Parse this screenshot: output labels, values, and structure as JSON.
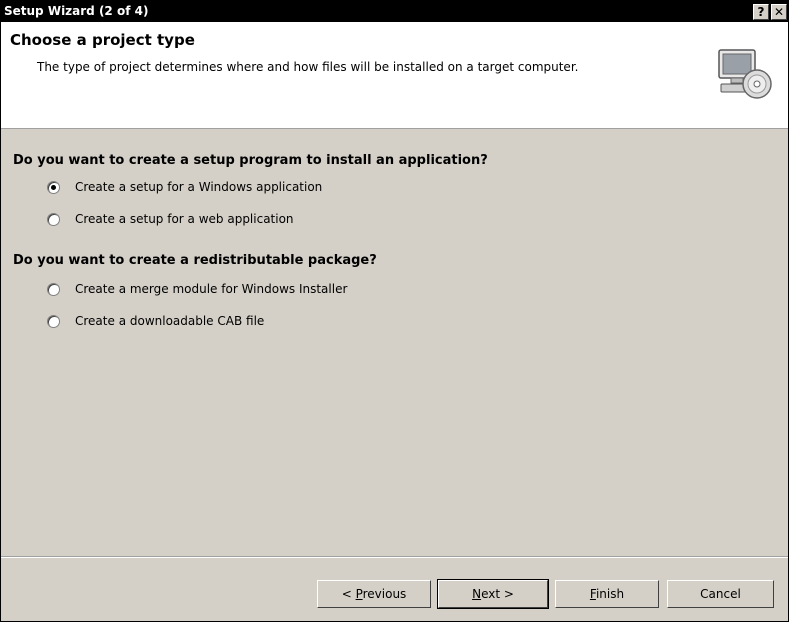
{
  "window": {
    "title": "Setup Wizard (2 of 4)",
    "help_label": "?",
    "close_label": "✕"
  },
  "header": {
    "title": "Choose a project type",
    "description": "The type of project determines where and how files will be installed on a target computer.",
    "icon": "computer-cd-icon"
  },
  "group1": {
    "question": "Do you want to create a setup program to install an application?",
    "options": [
      {
        "label": "Create a setup for a Windows application",
        "selected": true
      },
      {
        "label": "Create a setup for a web application",
        "selected": false
      }
    ]
  },
  "group2": {
    "question": "Do you want to create a redistributable package?",
    "options": [
      {
        "label": "Create a merge module for Windows Installer",
        "selected": false
      },
      {
        "label": "Create a downloadable CAB file",
        "selected": false
      }
    ]
  },
  "buttons": {
    "previous": {
      "prefix": "< ",
      "mnemonic": "P",
      "rest": "revious"
    },
    "next": {
      "mnemonic": "N",
      "rest": "ext >"
    },
    "finish": {
      "mnemonic": "F",
      "rest": "inish"
    },
    "cancel": {
      "label": "Cancel"
    }
  },
  "colors": {
    "title_bar": "#000000",
    "dialog_face": "#d4d0c8",
    "header_bg": "#ffffff"
  }
}
